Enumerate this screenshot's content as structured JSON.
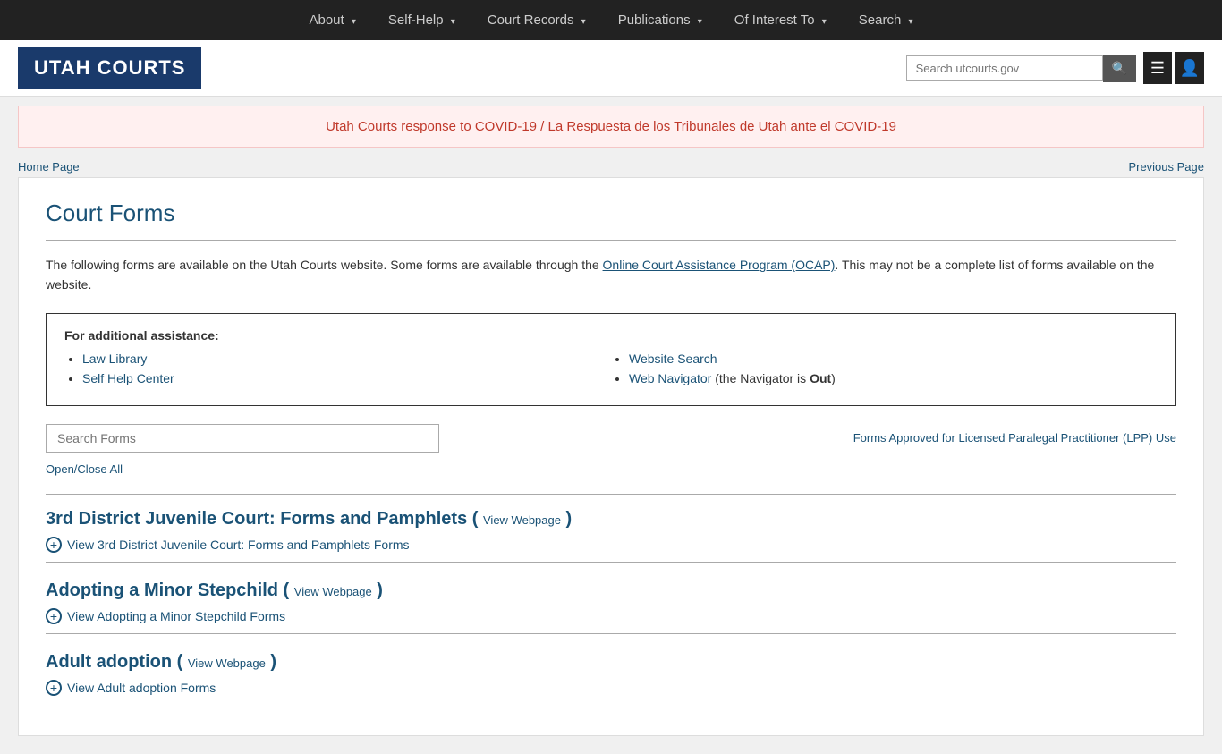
{
  "nav": {
    "items": [
      {
        "label": "About",
        "id": "about"
      },
      {
        "label": "Self-Help",
        "id": "self-help"
      },
      {
        "label": "Court Records",
        "id": "court-records"
      },
      {
        "label": "Publications",
        "id": "publications"
      },
      {
        "label": "Of Interest To",
        "id": "of-interest-to"
      },
      {
        "label": "Search",
        "id": "search"
      }
    ]
  },
  "header": {
    "logo": "UTAH COURTS",
    "search_placeholder": "Search utcourts.gov",
    "search_icon": "🔍"
  },
  "covid_banner": {
    "text": "Utah Courts response to COVID-19 / La Respuesta de los Tribunales de Utah ante el COVID-19"
  },
  "breadcrumb": {
    "home_label": "Home Page",
    "previous_label": "Previous Page"
  },
  "page": {
    "title": "Court Forms",
    "intro": "The following forms are available on the Utah Courts website. Some forms are available through the ",
    "ocap_link_text": "Online Court Assistance Program (OCAP)",
    "intro_suffix": ". This may not be a complete list of forms available on the website.",
    "assistance_title": "For additional assistance:",
    "links_left": [
      {
        "label": "Law Library",
        "href": "#"
      },
      {
        "label": "Self Help Center",
        "href": "#"
      }
    ],
    "links_right": [
      {
        "label": "Website Search",
        "href": "#"
      },
      {
        "label": "Web Navigator",
        "href": "#",
        "suffix": " (the Navigator is ",
        "bold": "Out",
        "suffix_end": ")"
      }
    ],
    "search_forms_placeholder": "Search Forms",
    "lpp_link": "Forms Approved for Licensed Paralegal Practitioner (LPP) Use",
    "open_close_all": "Open/Close All",
    "categories": [
      {
        "title": "3rd District Juvenile Court: Forms and Pamphlets",
        "view_webpage": "View Webpage",
        "view_forms_label": "View 3rd District Juvenile Court: Forms and Pamphlets Forms"
      },
      {
        "title": "Adopting a Minor Stepchild",
        "view_webpage": "View Webpage",
        "view_forms_label": "View Adopting a Minor Stepchild Forms"
      },
      {
        "title": "Adult adoption",
        "view_webpage": "View Webpage",
        "view_forms_label": "View Adult adoption Forms"
      }
    ]
  }
}
